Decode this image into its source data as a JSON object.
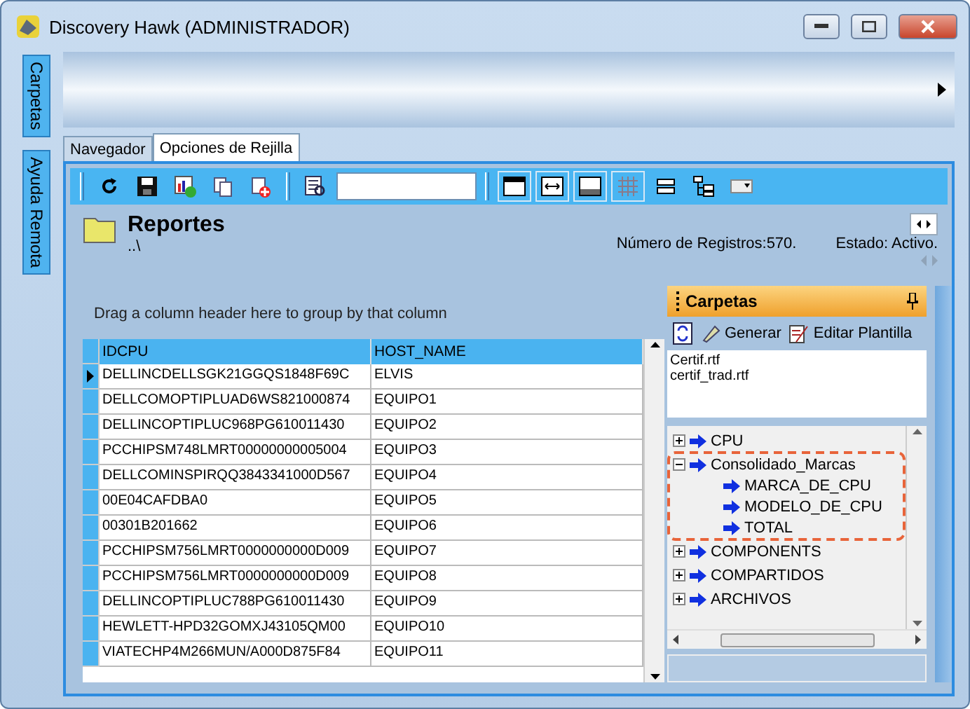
{
  "window": {
    "title": "Discovery Hawk (ADMINISTRADOR)"
  },
  "side_tabs": [
    {
      "label": "Carpetas"
    },
    {
      "label": "Ayuda Remota"
    }
  ],
  "tabs": [
    {
      "label": "Navegador",
      "selected": false
    },
    {
      "label": "Opciones de Rejilla",
      "selected": true
    }
  ],
  "report": {
    "title": "Reportes",
    "path": "..\\",
    "records": "Número de Registros:570.",
    "status": "Estado: Activo."
  },
  "grid": {
    "group_hint": "Drag a column header here to group by that column",
    "columns": [
      "IDCPU",
      "HOST_NAME"
    ],
    "rows": [
      {
        "cells": [
          "DELLINCDELLSGK21GGQS1848F69C",
          "ELVIS"
        ],
        "selected": true
      },
      {
        "cells": [
          "DELLCOMOPTIPLUAD6WS821000874",
          "EQUIPO1"
        ],
        "selected": false
      },
      {
        "cells": [
          "DELLINCOPTIPLUC968PG610011430",
          "EQUIPO2"
        ],
        "selected": false
      },
      {
        "cells": [
          "PCCHIPSM748LMRT00000000005004",
          "EQUIPO3"
        ],
        "selected": false
      },
      {
        "cells": [
          "DELLCOMINSPIRQQ3843341000D567",
          "EQUIPO4"
        ],
        "selected": false
      },
      {
        "cells": [
          "00E04CAFDBA0",
          "EQUIPO5"
        ],
        "selected": false
      },
      {
        "cells": [
          "00301B201662",
          "EQUIPO6"
        ],
        "selected": false
      },
      {
        "cells": [
          "PCCHIPSM756LMRT0000000000D009",
          "EQUIPO7"
        ],
        "selected": false
      },
      {
        "cells": [
          "PCCHIPSM756LMRT0000000000D009",
          "EQUIPO8"
        ],
        "selected": false
      },
      {
        "cells": [
          "DELLINCOPTIPLUC788PG610011430",
          "EQUIPO9"
        ],
        "selected": false
      },
      {
        "cells": [
          "HEWLETT-HPD32GOMXJ43105QM00",
          "EQUIPO10"
        ],
        "selected": false
      },
      {
        "cells": [
          "VIATECHP4M266MUN/A000D875F84",
          "EQUIPO11"
        ],
        "selected": false
      }
    ]
  },
  "folders_panel": {
    "title": "Carpetas",
    "actions": [
      "Generar",
      "Editar Plantilla"
    ],
    "files": [
      "Certif.rtf",
      "certif_trad.rtf"
    ],
    "tree": [
      {
        "label": "CPU",
        "expanded": false,
        "highlighted": false
      },
      {
        "label": "Consolidado_Marcas",
        "expanded": true,
        "highlighted": true,
        "children": [
          {
            "label": "MARCA_DE_CPU"
          },
          {
            "label": "MODELO_DE_CPU"
          },
          {
            "label": "TOTAL"
          }
        ]
      },
      {
        "label": "COMPONENTS",
        "expanded": false,
        "highlighted": false
      },
      {
        "label": "COMPARTIDOS",
        "expanded": false,
        "highlighted": false
      },
      {
        "label": "ARCHIVOS",
        "expanded": false,
        "highlighted": false
      }
    ]
  }
}
